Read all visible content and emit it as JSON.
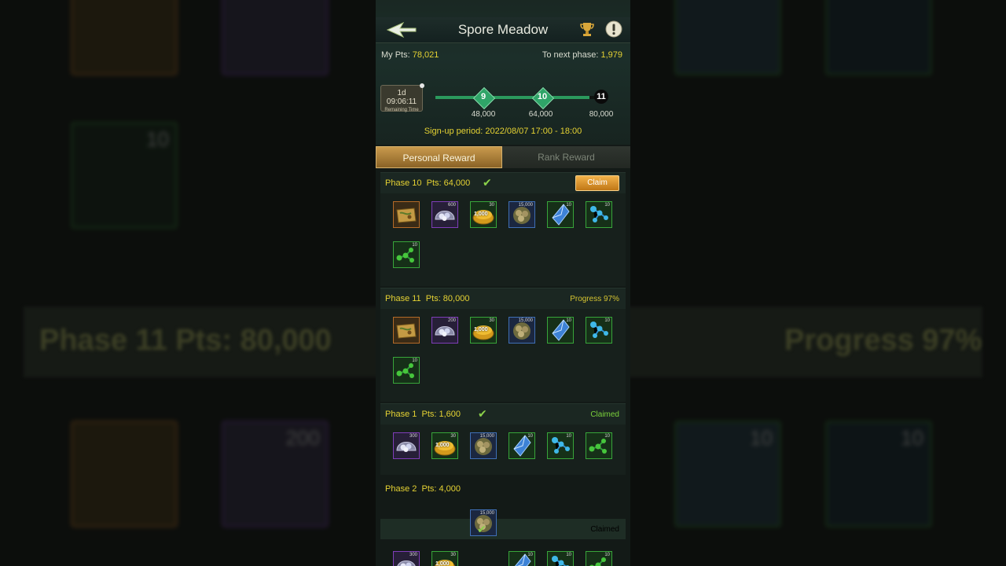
{
  "header": {
    "title": "Spore Meadow",
    "my_pts_label": "My Pts:",
    "my_pts_value": "78,021",
    "next_phase_label": "To next phase:",
    "next_phase_value": "1,979",
    "timer_value": "1d 09:06:11",
    "timer_caption": "Remaining Time",
    "signup_text": "Sign-up period: 2022/08/07 17:00 - 18:00"
  },
  "progress": {
    "nodes": [
      {
        "label": "9",
        "threshold": "48,000"
      },
      {
        "label": "10",
        "threshold": "64,000"
      },
      {
        "label": "11",
        "threshold": "80,000"
      }
    ],
    "fill_fraction": 0.97
  },
  "tabs": [
    {
      "label": "Personal Reward",
      "active": true
    },
    {
      "label": "Rank Reward",
      "active": false
    }
  ],
  "phases": [
    {
      "name": "Phase 10",
      "pts": "Pts: 64,000",
      "status": "Claim",
      "checked": true,
      "items": [
        {
          "icon": "treasure-map-icon",
          "qty": "",
          "rarity": "orange"
        },
        {
          "icon": "pearl-shell-icon",
          "qty": "600",
          "rarity": "purple"
        },
        {
          "icon": "gold-coin-pile-icon",
          "qty": "30",
          "rarity": "green",
          "inner": "1,000"
        },
        {
          "icon": "lumber-bundle-icon",
          "qty": "15,000",
          "rarity": "blue"
        },
        {
          "icon": "blue-crystal-icon",
          "qty": "10",
          "rarity": "green"
        },
        {
          "icon": "blue-molecule-icon",
          "qty": "10",
          "rarity": "green"
        },
        {
          "icon": "green-molecule-icon",
          "qty": "10",
          "rarity": "green"
        }
      ]
    },
    {
      "name": "Phase 11",
      "pts": "Pts: 80,000",
      "status": "Progress 97%",
      "checked": false,
      "items": [
        {
          "icon": "treasure-map-icon",
          "qty": "",
          "rarity": "orange"
        },
        {
          "icon": "pearl-shell-icon",
          "qty": "200",
          "rarity": "purple"
        },
        {
          "icon": "gold-coin-pile-icon",
          "qty": "30",
          "rarity": "green",
          "inner": "1,000"
        },
        {
          "icon": "lumber-bundle-icon",
          "qty": "15,000",
          "rarity": "blue"
        },
        {
          "icon": "blue-crystal-icon",
          "qty": "10",
          "rarity": "green"
        },
        {
          "icon": "blue-molecule-icon",
          "qty": "10",
          "rarity": "green"
        },
        {
          "icon": "green-molecule-icon",
          "qty": "10",
          "rarity": "green"
        }
      ]
    },
    {
      "name": "Phase 1",
      "pts": "Pts: 1,600",
      "status": "Claimed",
      "checked": true,
      "items": [
        {
          "icon": "pearl-shell-icon",
          "qty": "300",
          "rarity": "purple"
        },
        {
          "icon": "gold-coin-pile-icon",
          "qty": "30",
          "rarity": "green",
          "inner": "1,000"
        },
        {
          "icon": "lumber-bundle-icon",
          "qty": "15,000",
          "rarity": "blue"
        },
        {
          "icon": "blue-crystal-icon",
          "qty": "10",
          "rarity": "green"
        },
        {
          "icon": "blue-molecule-icon",
          "qty": "10",
          "rarity": "green"
        },
        {
          "icon": "green-molecule-icon",
          "qty": "10",
          "rarity": "green"
        }
      ]
    },
    {
      "name": "Phase 2",
      "pts": "Pts: 4,000",
      "status": "Claimed",
      "checked": true,
      "items": [
        {
          "icon": "lumber-bundle-icon",
          "qty": "15,000",
          "rarity": "blue"
        }
      ]
    }
  ],
  "bottom_row_items": [
    {
      "icon": "pearl-shell-icon",
      "qty": "300",
      "rarity": "purple"
    },
    {
      "icon": "gold-coin-pile-icon",
      "qty": "30",
      "rarity": "green",
      "inner": "1,000"
    },
    {
      "icon": "blue-crystal-icon",
      "qty": "10",
      "rarity": "green"
    },
    {
      "icon": "blue-molecule-icon",
      "qty": "10",
      "rarity": "green"
    },
    {
      "icon": "green-molecule-icon",
      "qty": "10",
      "rarity": "green"
    }
  ],
  "background_overlay": {
    "left_text": "Phase 11  Pts: 80,000",
    "right_text": "Progress 97%",
    "tile_numbers": [
      "10",
      "200",
      "10",
      "10"
    ]
  },
  "colors": {
    "accent_yellow": "#e5d233",
    "progress_green": "#2fa468",
    "claim_orange": "#f2b24a",
    "check_green": "#8bd14a"
  }
}
